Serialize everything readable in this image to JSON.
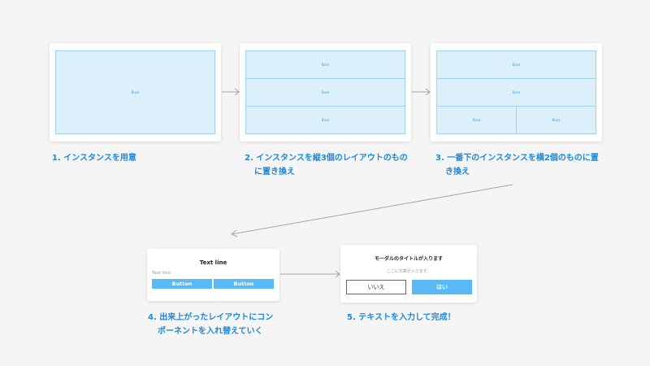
{
  "instance_label": "Base",
  "steps": [
    {
      "caption_lines": [
        "1. インスタンスを用意"
      ]
    },
    {
      "caption_lines": [
        "2. インスタンスを縦3個のレイアウトのもの",
        "に置き換え"
      ]
    },
    {
      "caption_lines": [
        "3. 一番下のインスタンスを横2個のものに置",
        "き換え"
      ]
    },
    {
      "caption_lines": [
        "4. 出来上がったレイアウトにコン",
        "ポーネントを入れ替えていく"
      ]
    },
    {
      "caption_lines": [
        "5. テキストを入力して完成！"
      ]
    }
  ],
  "component_card": {
    "title": "Text line",
    "subtitle": "Text line",
    "buttons": [
      "Button",
      "Button"
    ]
  },
  "modal_card": {
    "title": "モーダルのタイトルが入ります",
    "body": "ここに文章が入ります。",
    "no_label": "いいえ",
    "yes_label": "はい"
  },
  "colors": {
    "accent": "#1e88d8",
    "instance_fill": "#dcf0fc",
    "instance_border": "#9fd2f3",
    "button": "#58b9f5",
    "arrow": "#a6a6a6"
  }
}
